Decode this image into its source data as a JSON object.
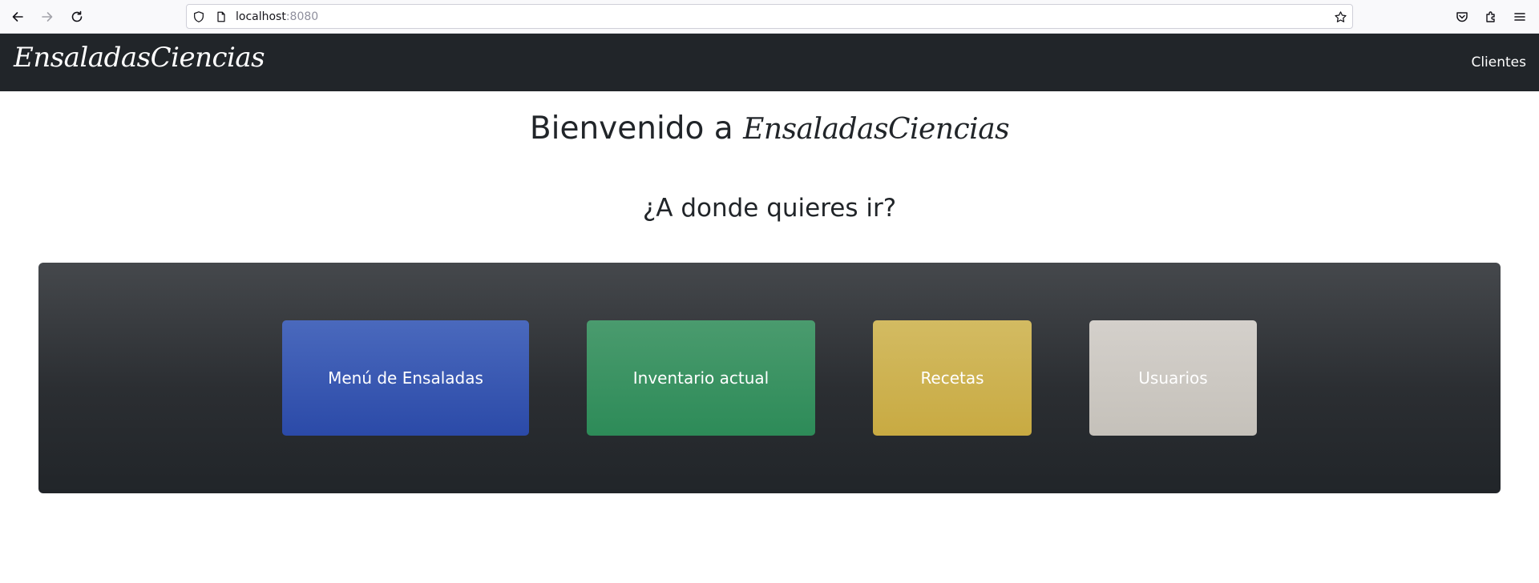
{
  "browser": {
    "url_host": "localhost",
    "url_port": ":8080",
    "icons": [
      "back-arrow-icon",
      "forward-arrow-icon",
      "reload-icon",
      "shield-icon",
      "page-icon",
      "star-icon",
      "pocket-icon",
      "extensions-icon",
      "menu-icon"
    ]
  },
  "navbar": {
    "brand": "EnsaladasCiencias",
    "link_clientes": "Clientes"
  },
  "main": {
    "welcome_prefix": "Bienvenido a ",
    "welcome_brand": "EnsaladasCiencias",
    "question": "¿A donde quieres ir?",
    "tiles": [
      {
        "label": "Menú de Ensaladas",
        "color": "#2b4aa8"
      },
      {
        "label": "Inventario actual",
        "color": "#2d8b58"
      },
      {
        "label": "Recetas",
        "color": "#c8aa42"
      },
      {
        "label": "Usuarios",
        "color": "#c5c1ba"
      }
    ]
  },
  "colors": {
    "navbar_bg": "#212529",
    "panel_bg": "#2b2e32"
  }
}
